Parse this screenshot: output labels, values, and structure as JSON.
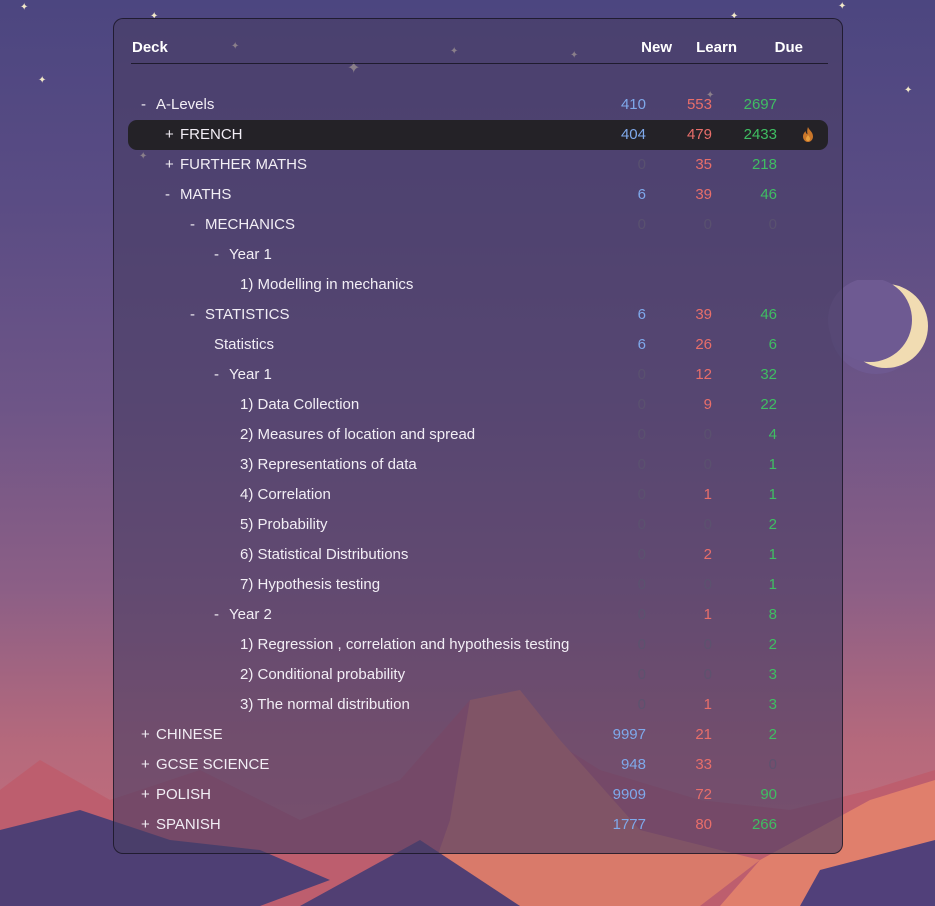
{
  "columns": {
    "deck": "Deck",
    "new": "New",
    "learn": "Learn",
    "due": "Due"
  },
  "colors": {
    "new": "#7fa9eb",
    "learn": "#e86e6a",
    "due": "#3fbe62",
    "zero": "#5a546e",
    "selected_row": "#242227"
  },
  "decks": [
    {
      "toggle": "-",
      "name": "A-Levels",
      "new": "410",
      "learn": "553",
      "due": "2697",
      "depth": 0
    },
    {
      "toggle": "+",
      "name": "FRENCH",
      "new": "404",
      "learn": "479",
      "due": "2433",
      "depth": 1,
      "selected": true,
      "icon": "flame-icon"
    },
    {
      "toggle": "+",
      "name": "FURTHER MATHS",
      "new": "0",
      "learn": "35",
      "due": "218",
      "depth": 1
    },
    {
      "toggle": "-",
      "name": "MATHS",
      "new": "6",
      "learn": "39",
      "due": "46",
      "depth": 1
    },
    {
      "toggle": "-",
      "name": "MECHANICS",
      "new": "0",
      "learn": "0",
      "due": "0",
      "depth": 2
    },
    {
      "toggle": "-",
      "name": "Year 1",
      "new": "",
      "learn": "",
      "due": "",
      "depth": 3
    },
    {
      "toggle": "",
      "name": "1) Modelling in mechanics",
      "new": "",
      "learn": "",
      "due": "",
      "depth": 4
    },
    {
      "toggle": "-",
      "name": "STATISTICS",
      "new": "6",
      "learn": "39",
      "due": "46",
      "depth": 2
    },
    {
      "toggle": "",
      "name": "Statistics",
      "new": "6",
      "learn": "26",
      "due": "6",
      "depth": 3
    },
    {
      "toggle": "-",
      "name": "Year 1",
      "new": "0",
      "learn": "12",
      "due": "32",
      "depth": 3
    },
    {
      "toggle": "",
      "name": "1) Data Collection",
      "new": "0",
      "learn": "9",
      "due": "22",
      "depth": 4
    },
    {
      "toggle": "",
      "name": "2) Measures of location and spread",
      "new": "0",
      "learn": "0",
      "due": "4",
      "depth": 4
    },
    {
      "toggle": "",
      "name": "3) Representations of data",
      "new": "0",
      "learn": "0",
      "due": "1",
      "depth": 4
    },
    {
      "toggle": "",
      "name": "4) Correlation",
      "new": "0",
      "learn": "1",
      "due": "1",
      "depth": 4
    },
    {
      "toggle": "",
      "name": "5) Probability",
      "new": "0",
      "learn": "0",
      "due": "2",
      "depth": 4
    },
    {
      "toggle": "",
      "name": "6) Statistical Distributions",
      "new": "0",
      "learn": "2",
      "due": "1",
      "depth": 4
    },
    {
      "toggle": "",
      "name": "7) Hypothesis testing",
      "new": "0",
      "learn": "0",
      "due": "1",
      "depth": 4
    },
    {
      "toggle": "-",
      "name": "Year 2",
      "new": "0",
      "learn": "1",
      "due": "8",
      "depth": 3
    },
    {
      "toggle": "",
      "name": "1) Regression , correlation and hypothesis testing",
      "new": "0",
      "learn": "0",
      "due": "2",
      "depth": 4
    },
    {
      "toggle": "",
      "name": "2) Conditional probability",
      "new": "0",
      "learn": "0",
      "due": "3",
      "depth": 4
    },
    {
      "toggle": "",
      "name": "3) The normal distribution",
      "new": "0",
      "learn": "1",
      "due": "3",
      "depth": 4
    },
    {
      "toggle": "+",
      "name": "CHINESE",
      "new": "9997",
      "learn": "21",
      "due": "2",
      "depth": 0
    },
    {
      "toggle": "+",
      "name": "GCSE SCIENCE",
      "new": "948",
      "learn": "33",
      "due": "0",
      "depth": 0
    },
    {
      "toggle": "+",
      "name": "POLISH",
      "new": "9909",
      "learn": "72",
      "due": "90",
      "depth": 0
    },
    {
      "toggle": "+",
      "name": "SPANISH",
      "new": "1777",
      "learn": "80",
      "due": "266",
      "depth": 0
    }
  ]
}
